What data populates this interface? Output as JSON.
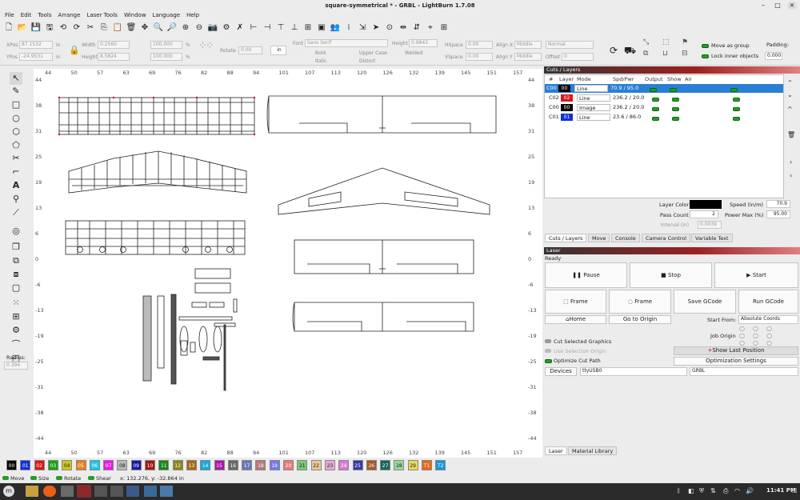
{
  "window": {
    "title": "square-symmetrical * - GRBL - LightBurn 1.7.08",
    "min": "–",
    "max": "□",
    "close": "×"
  },
  "menu": [
    "File",
    "Edit",
    "Tools",
    "Arrange",
    "Laser Tools",
    "Window",
    "Language",
    "Help"
  ],
  "props": {
    "xpos_label": "XPos",
    "xpos": "87.1532",
    "ypos_label": "YPos",
    "ypos": "-24.9531",
    "in1": "in",
    "in2": "in",
    "width_label": "Width",
    "width": "0.2560",
    "height_label": "Height",
    "height": "8.5824",
    "w_pct": "100.000",
    "h_pct": "100.000",
    "pct1": "%",
    "pct2": "%",
    "rotate_label": "Rotate",
    "rotate": "0.00",
    "unit_button": "in",
    "font_label": "Font",
    "font": "Sans Serif",
    "fheight_label": "Height",
    "fheight": "0.9843",
    "hspace_label": "HSpace",
    "hspace": "0.00",
    "vspace_label": "VSpace",
    "vspace": "0.00",
    "alignx_label": "Align X",
    "alignx": "Middle",
    "aligny_label": "Align Y",
    "aligny": "Middle",
    "normal": "Normal",
    "offset_label": "Offset",
    "offset": "0",
    "bold": "Bold",
    "italic": "Italic",
    "upper": "Upper Case",
    "distort": "Distort",
    "welded": "Welded",
    "move_group": "Move as group",
    "lock_inner": "Lock inner objects",
    "padding_label": "Padding:",
    "padding": "0.000"
  },
  "radius": {
    "label": "Radius:",
    "value": "0.394"
  },
  "ruler_top": [
    "44",
    "50",
    "57",
    "63",
    "69",
    "76",
    "82",
    "88",
    "94",
    "101",
    "107",
    "113",
    "120",
    "126",
    "132",
    "139",
    "145",
    "151",
    "157"
  ],
  "ruler_left": [
    "44",
    "38",
    "31",
    "25",
    "19",
    "13",
    "6",
    "0",
    "-6",
    "-13",
    "-19",
    "-25",
    "-31",
    "-38",
    "-44"
  ],
  "ruler_right": [
    "44",
    "38",
    "31",
    "25",
    "19",
    "13",
    "6",
    "0",
    "-6",
    "-13",
    "-19",
    "-25",
    "-31",
    "-38",
    "-44"
  ],
  "cuts": {
    "title": "Cuts / Layers",
    "headers": [
      "#",
      "Layer",
      "Mode",
      "Spd/Pwr",
      "Output",
      "Show",
      "Air"
    ],
    "rows": [
      {
        "id": "C00",
        "num": "00",
        "color": "#000000",
        "mode": "Line",
        "spd": "70.9 / 95.0"
      },
      {
        "id": "C02",
        "num": "02",
        "color": "#d81818",
        "mode": "Line",
        "spd": "236.2 / 20.0"
      },
      {
        "id": "C00",
        "num": "00",
        "color": "#000000",
        "mode": "Image",
        "spd": "236.2 / 20.0"
      },
      {
        "id": "C01",
        "num": "01",
        "color": "#1030d8",
        "mode": "Line",
        "spd": "23.6 / 86.0"
      }
    ],
    "layer_color_label": "Layer Color",
    "speed_label": "Speed (in/m)",
    "speed": "70.9",
    "pass_label": "Pass Count",
    "pass": "2",
    "power_label": "Power Max (%)",
    "power": "95.00",
    "interval_label": "Interval (in)",
    "interval": "0.0039"
  },
  "tabs": [
    "Cuts / Layers",
    "Move",
    "Console",
    "Camera Control",
    "Variable Text"
  ],
  "laser": {
    "title": "Laser",
    "status": "Ready",
    "pause": "Pause",
    "stop": "Stop",
    "start": "Start",
    "frame1": "Frame",
    "frame2": "Frame",
    "save_gcode": "Save GCode",
    "run_gcode": "Run GCode",
    "home": "Home",
    "goto_origin": "Go to Origin",
    "start_from_label": "Start From:",
    "start_from": "Absolute Coords",
    "job_origin": "Job Origin",
    "cut_selected": "Cut Selected Graphics",
    "use_origin": "Use Selection Origin",
    "show_last": "Show Last Position",
    "optimize": "Optimize Cut Path",
    "opt_settings": "Optimization Settings",
    "devices": "Devices",
    "port": "ttyUSB0",
    "device": "GRBL"
  },
  "bottom_tabs": [
    "Laser",
    "Material Library"
  ],
  "palette": [
    {
      "l": "00",
      "c": "#000000"
    },
    {
      "l": "01",
      "c": "#1030d8"
    },
    {
      "l": "02",
      "c": "#d81818"
    },
    {
      "l": "03",
      "c": "#18a018"
    },
    {
      "l": "04",
      "c": "#c8c818"
    },
    {
      "l": "05",
      "c": "#e88018"
    },
    {
      "l": "06",
      "c": "#18c8e8"
    },
    {
      "l": "07",
      "c": "#e818e8"
    },
    {
      "l": "08",
      "c": "#b8b8b8"
    },
    {
      "l": "09",
      "c": "#1818a0"
    },
    {
      "l": "10",
      "c": "#a01818"
    },
    {
      "l": "11",
      "c": "#188818"
    },
    {
      "l": "12",
      "c": "#888818"
    },
    {
      "l": "13",
      "c": "#a86818"
    },
    {
      "l": "14",
      "c": "#18a8d8"
    },
    {
      "l": "15",
      "c": "#a818a8"
    },
    {
      "l": "16",
      "c": "#686868"
    },
    {
      "l": "17",
      "c": "#6878b8"
    },
    {
      "l": "18",
      "c": "#b87878"
    },
    {
      "l": "19",
      "c": "#7878e8"
    },
    {
      "l": "20",
      "c": "#e87878"
    },
    {
      "l": "21",
      "c": "#78c878"
    },
    {
      "l": "22",
      "c": "#e8c898"
    },
    {
      "l": "23",
      "c": "#e8a8d8"
    },
    {
      "l": "24",
      "c": "#d878d8"
    },
    {
      "l": "25",
      "c": "#3838a8"
    },
    {
      "l": "26",
      "c": "#a85828"
    },
    {
      "l": "27",
      "c": "#186858"
    },
    {
      "l": "28",
      "c": "#98d898"
    },
    {
      "l": "29",
      "c": "#e8d858"
    },
    {
      "l": "T1",
      "c": "#e86818"
    },
    {
      "l": "T2",
      "c": "#1898d8"
    }
  ],
  "status": {
    "move": "Move",
    "size": "Size",
    "rotate": "Rotate",
    "shear": "Shear",
    "coords": "x: 132.276, y: -32.864 in"
  },
  "taskbar": {
    "clock": "11:41 PM"
  }
}
